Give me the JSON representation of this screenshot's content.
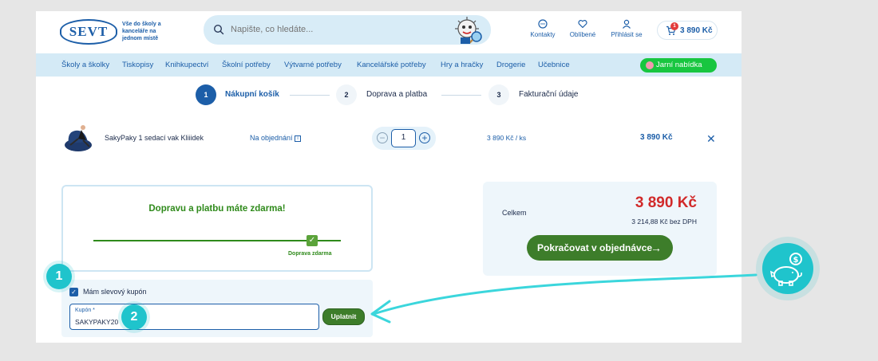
{
  "header": {
    "logo": "SEVT",
    "tagline": [
      "Vše do školy a",
      "kanceláře na",
      "jednom místě"
    ],
    "search_placeholder": "Napište, co hledáte...",
    "links": [
      {
        "label": "Kontakty",
        "icon": "chat-icon"
      },
      {
        "label": "Oblíbené",
        "icon": "heart-icon"
      },
      {
        "label": "Přihlásit se",
        "icon": "user-icon"
      }
    ],
    "cart": {
      "count": "1",
      "total": "3 890 Kč",
      "icon": "cart-icon"
    }
  },
  "nav": {
    "items": [
      "Školy a školky",
      "Tiskopisy",
      "Knihkupectví",
      "Školní potřeby",
      "Výtvarné potřeby",
      "Kancelářské potřeby",
      "Hry a hračky",
      "Drogerie",
      "Učebnice"
    ],
    "promo": "Jarní nabídka"
  },
  "steps": [
    {
      "number": "1",
      "label": "Nákupní košík",
      "active": true
    },
    {
      "number": "2",
      "label": "Doprava a platba",
      "active": false
    },
    {
      "number": "3",
      "label": "Fakturační údaje",
      "active": false
    }
  ],
  "cart_item": {
    "name": "SakyPaky 1 sedací vak Kliiidek",
    "availability": "Na objednání",
    "quantity": "1",
    "unit_price": "3 890 Kč / ks",
    "total": "3 890 Kč"
  },
  "shipping": {
    "message": "Dopravu a platbu máte zdarma!",
    "progress_label": "Doprava zdarma",
    "progress_fraction": 1.0
  },
  "summary": {
    "label": "Celkem",
    "total": "3 890 Kč",
    "without_vat": "3 214,88 Kč bez DPH",
    "continue_label": "Pokračovat v objednávce"
  },
  "coupon": {
    "checkbox_label": "Mám slevový kupón",
    "checked": true,
    "field_label": "Kupón *",
    "value": "SAKYPAKY20",
    "apply_label": "Uplatnit"
  },
  "annotations": {
    "badge_1": "1",
    "badge_2": "2"
  },
  "colors": {
    "brand_blue": "#1c5ea8",
    "green": "#3d7d2a",
    "promo_green": "#18c640",
    "price_red": "#d12a2a",
    "annotation_teal": "#1fc4cc"
  }
}
